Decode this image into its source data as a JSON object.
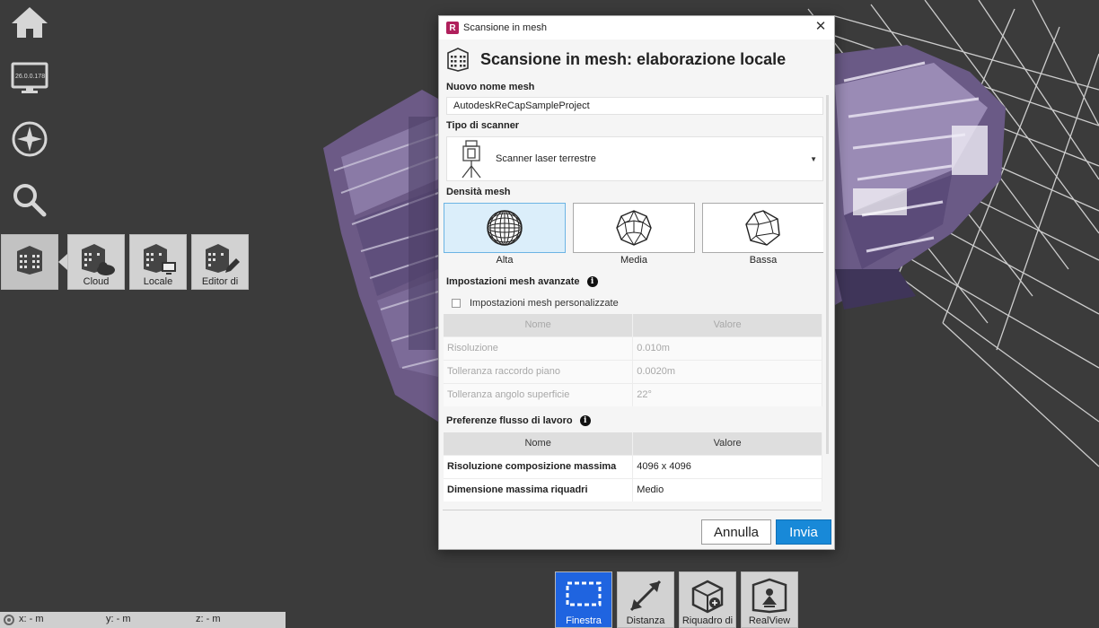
{
  "nav": {
    "ip_label": "26.0.0.178",
    "mesh_tools": [
      {
        "label": ""
      },
      {
        "label": "Cloud"
      },
      {
        "label": "Locale"
      },
      {
        "label": "Editor di"
      }
    ]
  },
  "status": {
    "x": "x:  - m",
    "y": "y:  - m",
    "z": "z:  - m"
  },
  "bottom_toolbar": [
    {
      "label": "Finestra"
    },
    {
      "label": "Distanza"
    },
    {
      "label": "Riquadro di"
    },
    {
      "label": "RealView"
    }
  ],
  "dialog": {
    "window_title": "Scansione in mesh",
    "app_logo": "R",
    "close_symbol": "✕",
    "heading": "Scansione in mesh: elaborazione locale",
    "name_label": "Nuovo nome mesh",
    "name_value": "AutodeskReCapSampleProject",
    "scanner_label": "Tipo di scanner",
    "scanner_value": "Scanner laser terrestre",
    "density_label": "Densità mesh",
    "density_options": [
      {
        "label": "Alta",
        "selected": true
      },
      {
        "label": "Media",
        "selected": false
      },
      {
        "label": "Bassa",
        "selected": false
      }
    ],
    "advanced_label": "Impostazioni mesh avanzate",
    "custom_checkbox_label": "Impostazioni mesh personalizzate",
    "custom_checked": false,
    "advanced_table": {
      "headers": [
        "Nome",
        "Valore"
      ],
      "rows": [
        [
          "Risoluzione",
          "0.010m"
        ],
        [
          "Tolleranza raccordo piano",
          "0.0020m"
        ],
        [
          "Tolleranza angolo superficie",
          "22°"
        ]
      ]
    },
    "workflow_label": "Preferenze flusso di lavoro",
    "workflow_table": {
      "headers": [
        "Nome",
        "Valore"
      ],
      "rows": [
        [
          "Risoluzione composizione massima",
          "4096 x 4096"
        ],
        [
          "Dimensione massima riquadri",
          "Medio"
        ]
      ]
    },
    "info_symbol": "i",
    "cancel_label": "Annulla",
    "submit_label": "Invia"
  },
  "colors": {
    "accent_blue": "#1889d8",
    "active_tool_blue": "#1f64e0",
    "selected_card": "#dbeefa",
    "background": "#3b3b3b"
  },
  "icons": [
    "home-icon",
    "monitor-icon",
    "compass-icon",
    "search-icon",
    "building-mesh-icon",
    "cloud-icon",
    "window-select-icon",
    "distance-icon",
    "box-icon",
    "realview-icon",
    "sphere-high-icon",
    "sphere-medium-icon",
    "sphere-low-icon",
    "scanner-icon"
  ]
}
